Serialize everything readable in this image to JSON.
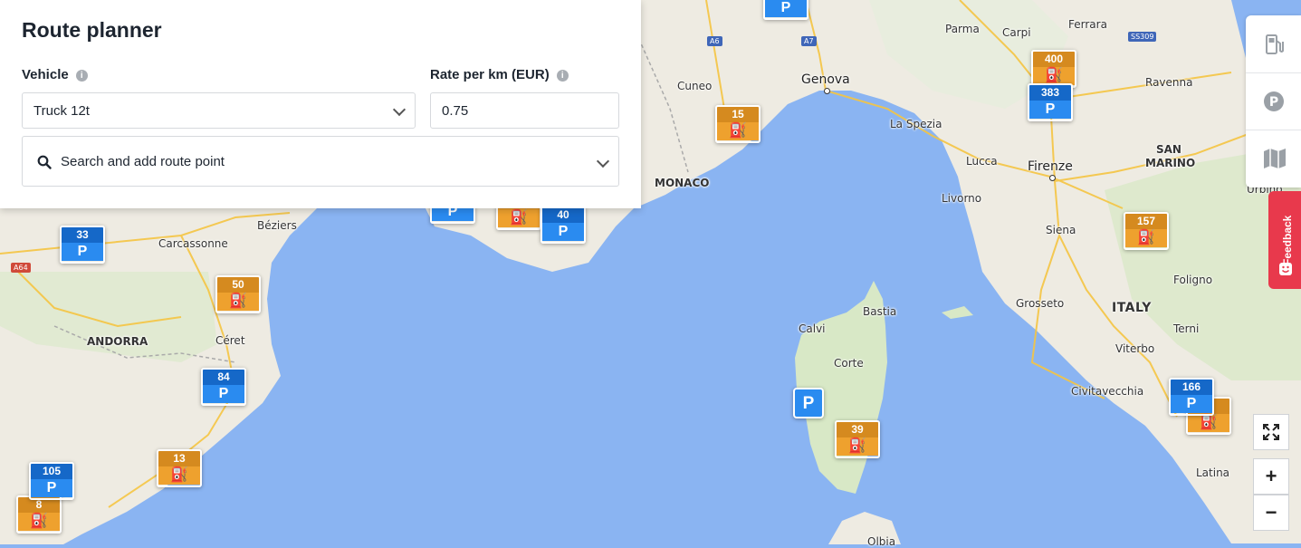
{
  "planner": {
    "title": "Route planner",
    "vehicle_label": "Vehicle",
    "vehicle_value": "Truck 12t",
    "rate_label": "Rate per km (EUR)",
    "rate_value": "0.75",
    "search_placeholder": "Search and add route point"
  },
  "toolbar": {
    "items": [
      {
        "name": "fuel-station-layer",
        "icon": "fuel-pump-icon"
      },
      {
        "name": "parking-layer",
        "icon": "parking-icon"
      },
      {
        "name": "map-layer",
        "icon": "map-icon"
      }
    ]
  },
  "feedback_label": "Feedback",
  "controls": {
    "fullscreen": "fullscreen-icon",
    "zoom_in": "+",
    "zoom_out": "−"
  },
  "places": [
    {
      "name": "Genova",
      "cls": "big"
    },
    {
      "name": "Cuneo"
    },
    {
      "name": "Parma"
    },
    {
      "name": "Carpi"
    },
    {
      "name": "Ferrara"
    },
    {
      "name": "Ravenna"
    },
    {
      "name": "La Spezia"
    },
    {
      "name": "Lucca"
    },
    {
      "name": "Firenze",
      "cls": "big"
    },
    {
      "name": "SAN",
      "cls": "smallcaps"
    },
    {
      "name": "MARINO",
      "cls": "smallcaps"
    },
    {
      "name": "Livorno"
    },
    {
      "name": "Siena"
    },
    {
      "name": "Grosseto"
    },
    {
      "name": "Foligno"
    },
    {
      "name": "ITALY",
      "cls": "country"
    },
    {
      "name": "Terni"
    },
    {
      "name": "Viterbo"
    },
    {
      "name": "Civitavecchia"
    },
    {
      "name": "Latina"
    },
    {
      "name": "MONACO",
      "cls": "smallcaps"
    },
    {
      "name": "Béziers"
    },
    {
      "name": "Carcassonne"
    },
    {
      "name": "ANDORRA",
      "cls": "smallcaps"
    },
    {
      "name": "Céret"
    },
    {
      "name": "Bastia"
    },
    {
      "name": "Calvi"
    },
    {
      "name": "Corte"
    },
    {
      "name": "Olbia"
    },
    {
      "name": "Urbino"
    }
  ],
  "roads": [
    "A6",
    "A7",
    "SS309",
    "A64"
  ],
  "markers": [
    {
      "type": "fuel",
      "count": "400"
    },
    {
      "type": "park",
      "count": "383"
    },
    {
      "type": "fuel",
      "count": "15"
    },
    {
      "type": "fuel",
      "count": "157"
    },
    {
      "type": "park",
      "count": "40"
    },
    {
      "type": "park",
      "count": "33"
    },
    {
      "type": "fuel",
      "count": "50"
    },
    {
      "type": "park",
      "count": "84"
    },
    {
      "type": "fuel",
      "count": "13"
    },
    {
      "type": "park",
      "count": "105"
    },
    {
      "type": "fuel",
      "count": "8"
    },
    {
      "type": "fuel",
      "count": "39"
    },
    {
      "type": "park",
      "count": "166"
    }
  ],
  "colors": {
    "sea": "#8ab4f2",
    "land": "#f0ede4",
    "forest": "#d6e7c4",
    "fuel_marker": "#eea12e",
    "parking_marker": "#2a8bf0",
    "feedback": "#e8394c"
  }
}
